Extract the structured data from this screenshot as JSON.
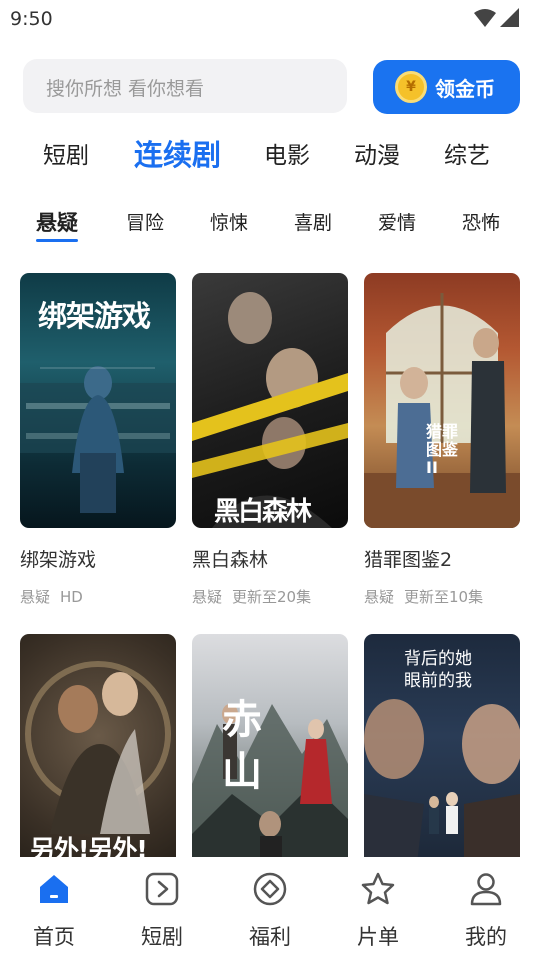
{
  "status_bar": {
    "time": "9:50"
  },
  "search": {
    "placeholder": "搜你所想 看你想看"
  },
  "coin_button": {
    "label": "领金币",
    "icon_glyph": "¥"
  },
  "main_tabs": [
    {
      "label": "短剧",
      "active": false
    },
    {
      "label": "连续剧",
      "active": true
    },
    {
      "label": "电影",
      "active": false
    },
    {
      "label": "动漫",
      "active": false
    },
    {
      "label": "综艺",
      "active": false
    }
  ],
  "sub_tabs": [
    {
      "label": "悬疑",
      "active": true
    },
    {
      "label": "冒险",
      "active": false
    },
    {
      "label": "惊悚",
      "active": false
    },
    {
      "label": "喜剧",
      "active": false
    },
    {
      "label": "爱情",
      "active": false
    },
    {
      "label": "恐怖",
      "active": false
    }
  ],
  "cards": [
    {
      "title": "绑架游戏",
      "genre": "悬疑",
      "status": "HD",
      "poster_text": "绑架游戏"
    },
    {
      "title": "黑白森林",
      "genre": "悬疑",
      "status": "更新至20集",
      "poster_text": "黑白森林"
    },
    {
      "title": "猎罪图鉴2",
      "genre": "悬疑",
      "status": "更新至10集",
      "poster_text": "猎罪图鉴II"
    },
    {
      "title": "",
      "genre": "",
      "status": "",
      "poster_text": "另外!另外!"
    },
    {
      "title": "",
      "genre": "",
      "status": "",
      "poster_text": "赤山"
    },
    {
      "title": "",
      "genre": "",
      "status": "",
      "poster_text": "背后的她 眼前的我"
    }
  ],
  "bottom_nav": [
    {
      "label": "首页",
      "icon": "home-icon",
      "active": true
    },
    {
      "label": "短剧",
      "icon": "play-icon",
      "active": false
    },
    {
      "label": "福利",
      "icon": "welfare-icon",
      "active": false
    },
    {
      "label": "片单",
      "icon": "star-icon",
      "active": false
    },
    {
      "label": "我的",
      "icon": "profile-icon",
      "active": false
    }
  ],
  "colors": {
    "accent": "#1a6ff0",
    "coin_button": "#1a73f0",
    "coin": "#f5c12a",
    "muted": "#999999"
  }
}
